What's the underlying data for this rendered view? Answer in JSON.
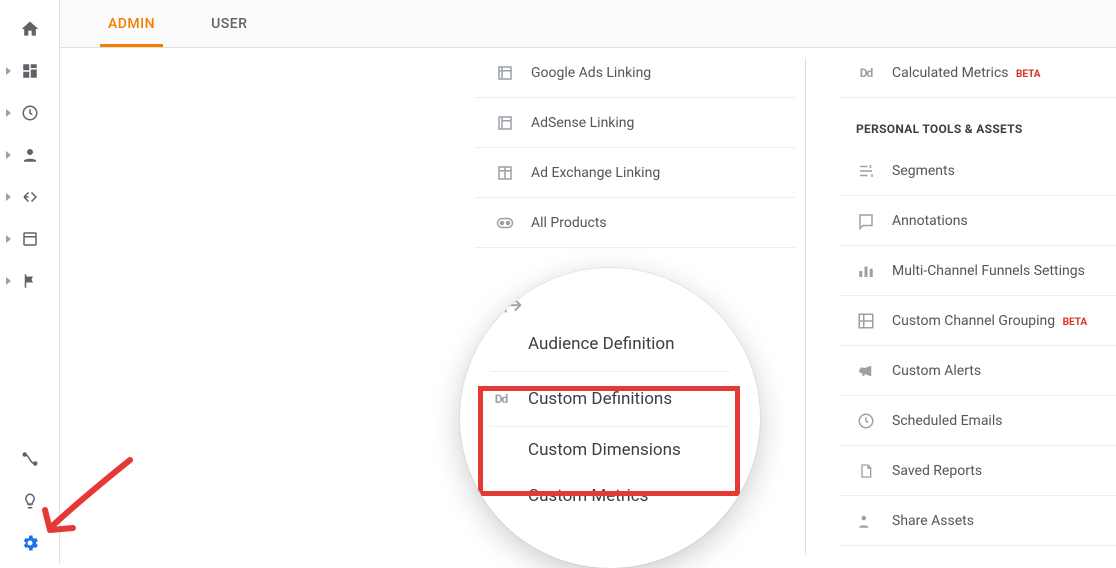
{
  "tabs": {
    "admin": "ADMIN",
    "user": "USER"
  },
  "rail": {
    "home": "home-icon",
    "dashboards": "dashboards-icon",
    "realtime": "clock-icon",
    "audience": "person-icon",
    "acquisition": "path-icon",
    "behavior": "page-icon",
    "conversions": "flag-icon",
    "attribution": "attribution-icon",
    "discover": "bulb-icon",
    "admin": "gear-icon"
  },
  "col2": {
    "items": [
      {
        "label": "Google Ads Linking",
        "icon": "page-icon"
      },
      {
        "label": "AdSense Linking",
        "icon": "page-icon"
      },
      {
        "label": "Ad Exchange Linking",
        "icon": "layout-icon"
      },
      {
        "label": "All Products",
        "icon": "link-icon"
      }
    ]
  },
  "zoom": {
    "audDef": "Audience Definition",
    "customDefs": "Custom Definitions",
    "customDims": "Custom Dimensions",
    "customMetrics": "Custom Metrics"
  },
  "col3": {
    "calcMetrics": "Calculated Metrics",
    "beta": "BETA",
    "sectionTitle": "PERSONAL TOOLS & ASSETS",
    "items": [
      {
        "label": "Segments",
        "icon": "segments-icon"
      },
      {
        "label": "Annotations",
        "icon": "note-icon"
      },
      {
        "label": "Multi-Channel Funnels Settings",
        "icon": "bars-icon"
      },
      {
        "label": "Custom Channel Grouping",
        "icon": "group-icon",
        "beta": true
      },
      {
        "label": "Custom Alerts",
        "icon": "megaphone-icon"
      },
      {
        "label": "Scheduled Emails",
        "icon": "clock-icon"
      },
      {
        "label": "Saved Reports",
        "icon": "file-icon"
      },
      {
        "label": "Share Assets",
        "icon": "share-person-icon"
      }
    ]
  }
}
